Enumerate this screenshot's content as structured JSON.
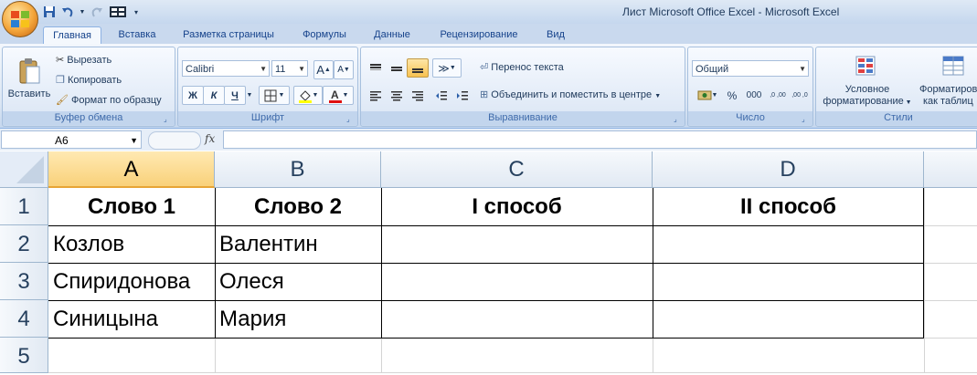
{
  "window": {
    "title": "Лист Microsoft Office Excel - Microsoft Excel"
  },
  "quick_access": [
    "save-icon",
    "undo-icon",
    "redo-icon",
    "grid-icon",
    "customize-icon"
  ],
  "tabs": [
    {
      "label": "Главная",
      "active": true
    },
    {
      "label": "Вставка"
    },
    {
      "label": "Разметка страницы"
    },
    {
      "label": "Формулы"
    },
    {
      "label": "Данные"
    },
    {
      "label": "Рецензирование"
    },
    {
      "label": "Вид"
    }
  ],
  "ribbon": {
    "clipboard": {
      "label": "Буфер обмена",
      "paste": "Вставить",
      "cut": "Вырезать",
      "copy": "Копировать",
      "format_painter": "Формат по образцу"
    },
    "font": {
      "label": "Шрифт",
      "family": "Calibri",
      "size": "11",
      "bold": "Ж",
      "italic": "К",
      "underline": "Ч",
      "grow": "A",
      "shrink": "A"
    },
    "alignment": {
      "label": "Выравнивание",
      "wrap": "Перенос текста",
      "merge": "Объединить и поместить в центре"
    },
    "number": {
      "label": "Число",
      "format": "Общий",
      "percent": "%",
      "thousands": "000",
      "inc_decimal": ",0 ,00",
      "dec_decimal": ",00 ,0"
    },
    "styles": {
      "label": "Стили",
      "conditional_line1": "Условное",
      "conditional_line2": "форматирование",
      "table_line1": "Форматиров",
      "table_line2": "как таблиц"
    }
  },
  "formula_bar": {
    "name_box": "A6",
    "fx": "fx",
    "content": ""
  },
  "sheet": {
    "columns": [
      "A",
      "B",
      "C",
      "D"
    ],
    "selected_column": "A",
    "rows": [
      "1",
      "2",
      "3",
      "4",
      "5"
    ],
    "cells": {
      "A1": "Слово 1",
      "B1": "Слово 2",
      "C1": "I способ",
      "D1": "II способ",
      "A2": "Козлов",
      "B2": "Валентин",
      "A3": "Спиридонова",
      "B3": "Олеся",
      "A4": "Синицына",
      "B4": "Мария"
    }
  },
  "colors": {
    "accent": "#15428b",
    "selected_header": "#f9d17a",
    "ribbon_border": "#8db2e3"
  }
}
